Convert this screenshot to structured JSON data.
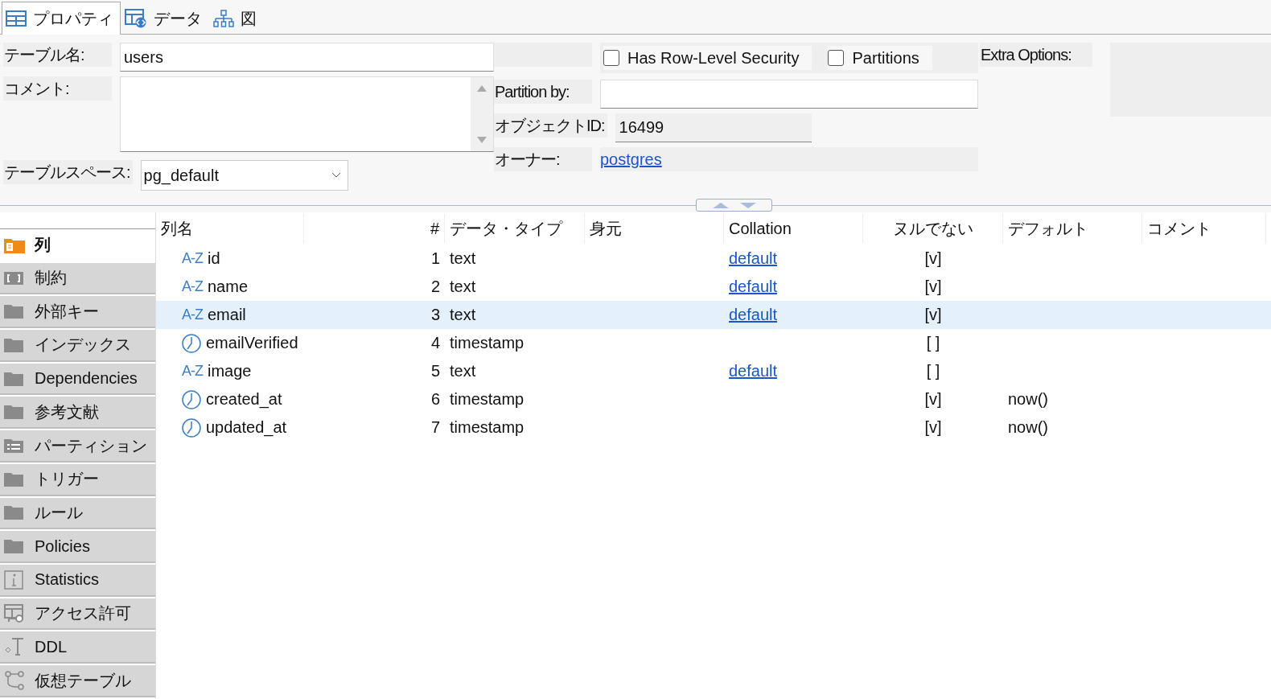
{
  "tabs": [
    {
      "label": "プロパティ",
      "kind": "table",
      "selected": true
    },
    {
      "label": "データ",
      "kind": "data",
      "selected": false
    },
    {
      "label": "図",
      "kind": "diagram",
      "selected": false
    }
  ],
  "form": {
    "table_name": {
      "label": "テーブル名:",
      "value": "users"
    },
    "comment": {
      "label": "コメント:"
    },
    "tablespace": {
      "label": "テーブルスペース:",
      "value": "pg_default"
    },
    "options": [
      {
        "label": "Has Row-Level Security",
        "checked": false
      },
      {
        "label": "Partitions",
        "checked": false
      }
    ],
    "partition_by": {
      "label": "Partition by:"
    },
    "object_id": {
      "label": "オブジェクトID:",
      "value": "16499"
    },
    "owner": {
      "label": "オーナー:",
      "value": "postgres"
    },
    "extra_options": {
      "label": "Extra Options:"
    }
  },
  "sidebar": {
    "items": [
      {
        "label": "列",
        "kind": "columns",
        "selected": true
      },
      {
        "label": "制約",
        "kind": "bracket",
        "selected": false
      },
      {
        "label": "外部キー",
        "kind": "folder",
        "selected": false
      },
      {
        "label": "インデックス",
        "kind": "folder",
        "selected": false
      },
      {
        "label": "Dependencies",
        "kind": "folder",
        "selected": false
      },
      {
        "label": "参考文献",
        "kind": "folder",
        "selected": false
      },
      {
        "label": "パーティション",
        "kind": "list",
        "selected": false
      },
      {
        "label": "トリガー",
        "kind": "folder",
        "selected": false
      },
      {
        "label": "ルール",
        "kind": "folder",
        "selected": false
      },
      {
        "label": "Policies",
        "kind": "folder",
        "selected": false
      },
      {
        "label": "Statistics",
        "kind": "info",
        "selected": false
      },
      {
        "label": "アクセス許可",
        "kind": "key",
        "selected": false
      },
      {
        "label": "DDL",
        "kind": "ddl",
        "selected": false
      },
      {
        "label": "仮想テーブル",
        "kind": "nodes",
        "selected": false
      }
    ]
  },
  "table": {
    "columns": [
      "列名",
      "#",
      "データ・タイプ",
      "身元",
      "Collation",
      "ヌルでない",
      "デフォルト",
      "コメント"
    ],
    "rows": [
      {
        "kind": "letters",
        "icon_text": "A-Z",
        "name": "id",
        "num": "1",
        "type": "text",
        "collation": "default",
        "not_null": "[v]",
        "selected": false
      },
      {
        "kind": "letters",
        "icon_text": "A-Z",
        "name": "name",
        "num": "2",
        "type": "text",
        "collation": "default",
        "not_null": "[v]",
        "selected": false
      },
      {
        "kind": "letters",
        "icon_text": "A-Z",
        "name": "email",
        "num": "3",
        "type": "text",
        "collation": "default",
        "not_null": "[v]",
        "selected": true
      },
      {
        "kind": "clock",
        "name": "emailVerified",
        "num": "4",
        "type": "timestamp",
        "not_null": "[ ]",
        "selected": false
      },
      {
        "kind": "letters",
        "icon_text": "A-Z",
        "name": "image",
        "num": "5",
        "type": "text",
        "collation": "default",
        "not_null": "[ ]",
        "selected": false
      },
      {
        "kind": "clock",
        "name": "created_at",
        "num": "6",
        "type": "timestamp",
        "not_null": "[v]",
        "default": "now()",
        "selected": false
      },
      {
        "kind": "clock",
        "name": "updated_at",
        "num": "7",
        "type": "timestamp",
        "not_null": "[v]",
        "default": "now()",
        "selected": false
      }
    ]
  }
}
